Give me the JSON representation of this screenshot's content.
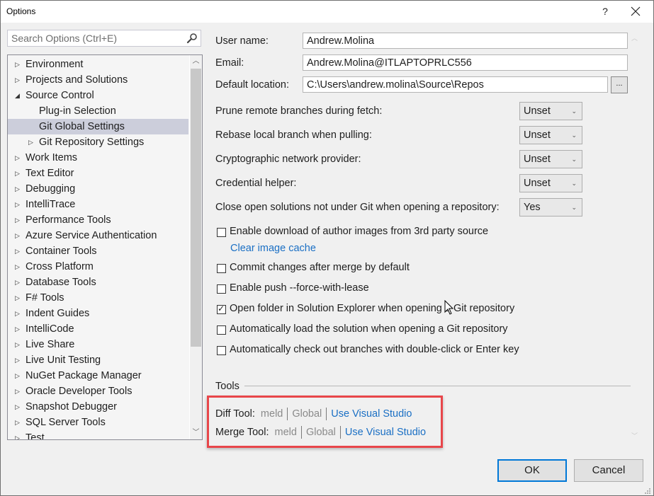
{
  "window": {
    "title": "Options",
    "help_label": "?",
    "close_label": "✕"
  },
  "search": {
    "placeholder": "Search Options (Ctrl+E)",
    "value": ""
  },
  "tree": {
    "items": [
      {
        "label": "Environment",
        "level": 0,
        "expander": "collapsed"
      },
      {
        "label": "Projects and Solutions",
        "level": 0,
        "expander": "collapsed"
      },
      {
        "label": "Source Control",
        "level": 0,
        "expander": "expanded"
      },
      {
        "label": "Plug-in Selection",
        "level": 1,
        "expander": "none"
      },
      {
        "label": "Git Global Settings",
        "level": 1,
        "expander": "none",
        "selected": true
      },
      {
        "label": "Git Repository Settings",
        "level": 1,
        "expander": "collapsed"
      },
      {
        "label": "Work Items",
        "level": 0,
        "expander": "collapsed"
      },
      {
        "label": "Text Editor",
        "level": 0,
        "expander": "collapsed"
      },
      {
        "label": "Debugging",
        "level": 0,
        "expander": "collapsed"
      },
      {
        "label": "IntelliTrace",
        "level": 0,
        "expander": "collapsed"
      },
      {
        "label": "Performance Tools",
        "level": 0,
        "expander": "collapsed"
      },
      {
        "label": "Azure Service Authentication",
        "level": 0,
        "expander": "collapsed"
      },
      {
        "label": "Container Tools",
        "level": 0,
        "expander": "collapsed"
      },
      {
        "label": "Cross Platform",
        "level": 0,
        "expander": "collapsed"
      },
      {
        "label": "Database Tools",
        "level": 0,
        "expander": "collapsed"
      },
      {
        "label": "F# Tools",
        "level": 0,
        "expander": "collapsed"
      },
      {
        "label": "Indent Guides",
        "level": 0,
        "expander": "collapsed"
      },
      {
        "label": "IntelliCode",
        "level": 0,
        "expander": "collapsed"
      },
      {
        "label": "Live Share",
        "level": 0,
        "expander": "collapsed"
      },
      {
        "label": "Live Unit Testing",
        "level": 0,
        "expander": "collapsed"
      },
      {
        "label": "NuGet Package Manager",
        "level": 0,
        "expander": "collapsed"
      },
      {
        "label": "Oracle Developer Tools",
        "level": 0,
        "expander": "collapsed"
      },
      {
        "label": "Snapshot Debugger",
        "level": 0,
        "expander": "collapsed"
      },
      {
        "label": "SQL Server Tools",
        "level": 0,
        "expander": "collapsed"
      },
      {
        "label": "Test",
        "level": 0,
        "expander": "collapsed"
      }
    ]
  },
  "form": {
    "user_name_label": "User name:",
    "user_name_value": "Andrew.Molina",
    "email_label": "Email:",
    "email_value": "Andrew.Molina@ITLAPTOPRLC556",
    "location_label": "Default location:",
    "location_value": "C:\\Users\\andrew.molina\\Source\\Repos",
    "browse_label": "...",
    "dropdowns": [
      {
        "label": "Prune remote branches during fetch:",
        "value": "Unset"
      },
      {
        "label": "Rebase local branch when pulling:",
        "value": "Unset"
      },
      {
        "label": "Cryptographic network provider:",
        "value": "Unset"
      },
      {
        "label": "Credential helper:",
        "value": "Unset"
      },
      {
        "label": "Close open solutions not under Git when opening a repository:",
        "value": "Yes"
      }
    ],
    "checkboxes": [
      {
        "label": "Enable download of author images from 3rd party source",
        "checked": false
      },
      {
        "label": "Commit changes after merge by default",
        "checked": false
      },
      {
        "label": "Enable push --force-with-lease",
        "checked": false
      },
      {
        "label": "Open folder in Solution Explorer when opening a Git repository",
        "checked": true
      },
      {
        "label": "Automatically load the solution when opening a Git repository",
        "checked": false
      },
      {
        "label": "Automatically check out branches with double-click or Enter key",
        "checked": false
      }
    ],
    "clear_cache_link": "Clear image cache"
  },
  "tools": {
    "section_title": "Tools",
    "diff": {
      "label": "Diff Tool:",
      "tool": "meld",
      "scope": "Global",
      "action": "Use Visual Studio"
    },
    "merge": {
      "label": "Merge Tool:",
      "tool": "meld",
      "scope": "Global",
      "action": "Use Visual Studio"
    }
  },
  "buttons": {
    "ok": "OK",
    "cancel": "Cancel"
  },
  "colors": {
    "accent": "#0078d7",
    "link": "#1a6fc4",
    "selection": "#cccedb",
    "highlight_box": "#e8464a"
  }
}
